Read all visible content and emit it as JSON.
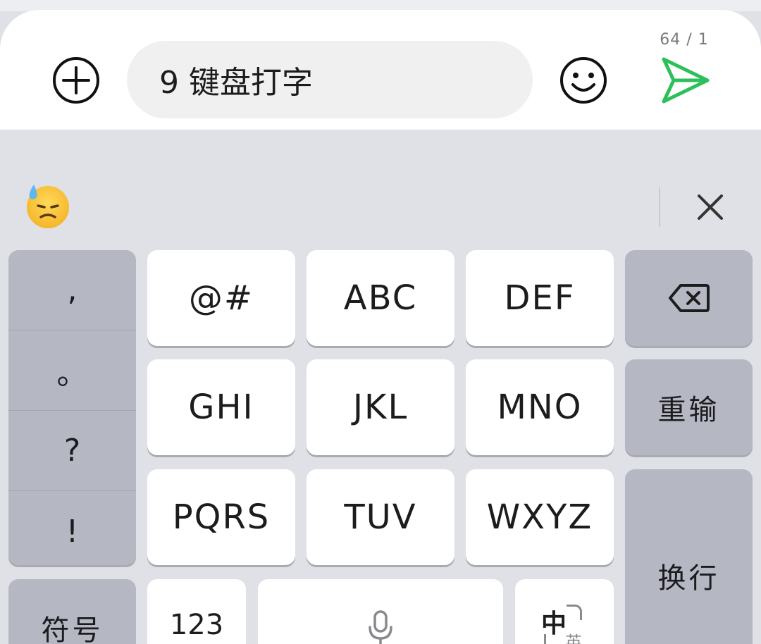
{
  "input_bar": {
    "text": "9 键盘打字",
    "counter": "64 / 1",
    "icons": {
      "add": "plus-circle-icon",
      "emoji": "smiley-icon",
      "send": "send-icon"
    },
    "send_color": "#2cc05a"
  },
  "candidates": {
    "emoji": "😓",
    "close_icon": "close-icon"
  },
  "keyboard": {
    "punctuation": [
      ",",
      "。",
      "?",
      "!"
    ],
    "keys": {
      "k1": "@#",
      "k2": "ABC",
      "k3": "DEF",
      "k4": "GHI",
      "k5": "JKL",
      "k6": "MNO",
      "k7": "PQRS",
      "k8": "TUV",
      "k9": "WXYZ"
    },
    "backspace_icon": "backspace-icon",
    "retype": "重输",
    "enter": "换行",
    "symbols": "符号",
    "numbers": "123",
    "mic_icon": "microphone-icon",
    "lang": {
      "zh": "中",
      "en": "英"
    }
  },
  "colors": {
    "keyboard_bg": "#dfe1e6",
    "key_light": "#ffffff",
    "key_dark": "#b5b8c3",
    "accent": "#2cc05a"
  }
}
